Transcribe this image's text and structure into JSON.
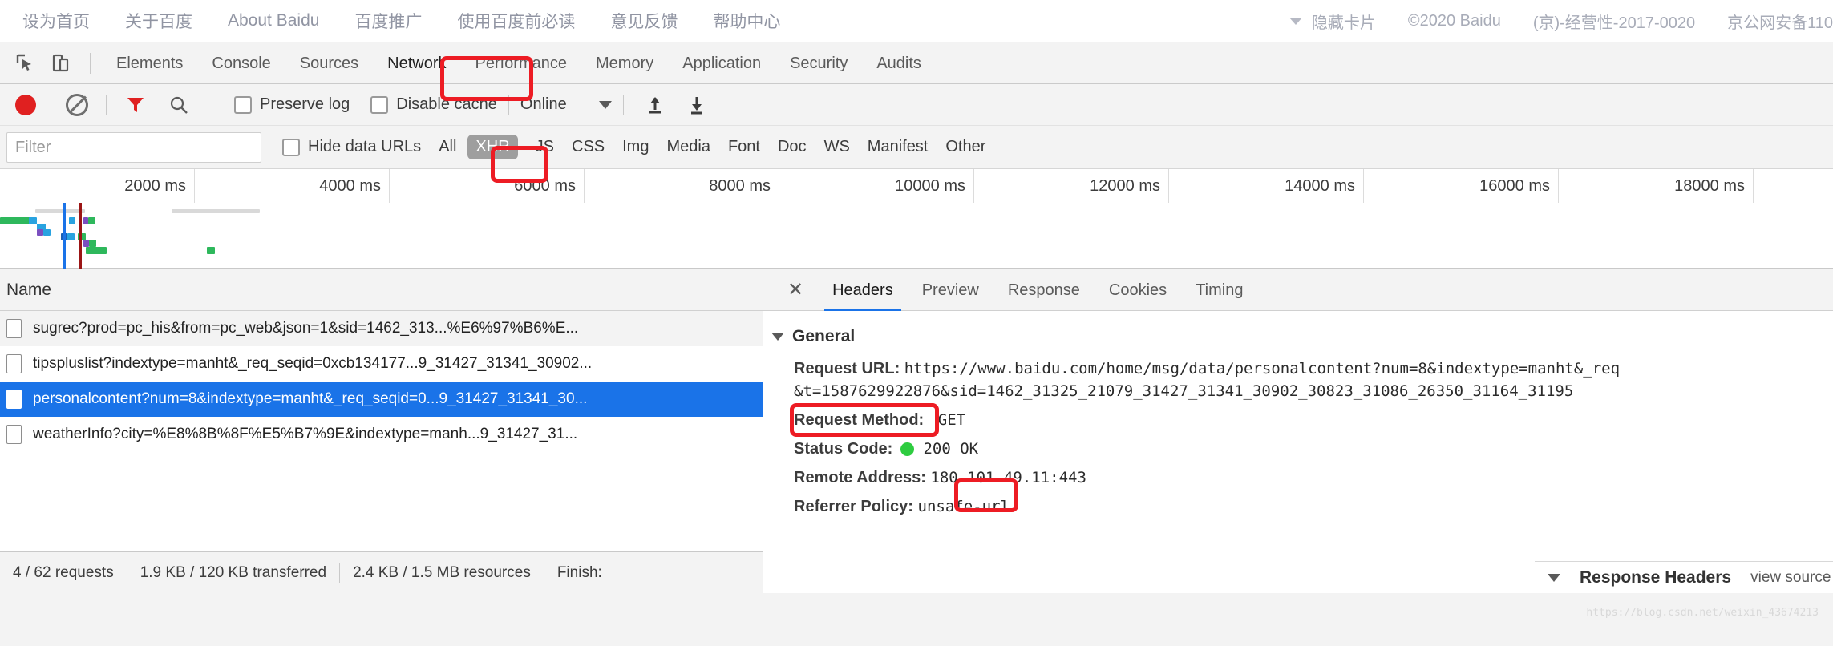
{
  "baidu_footer": {
    "links": [
      "设为首页",
      "关于百度",
      "About Baidu",
      "百度推广",
      "使用百度前必读",
      "意见反馈",
      "帮助中心"
    ],
    "hide_cards": "隐藏卡片",
    "copyright": "©2020 Baidu",
    "license": "(京)-经营性-2017-0020",
    "icp": "京公网安备110"
  },
  "devtools": {
    "tabs": [
      {
        "label": "Elements",
        "active": false
      },
      {
        "label": "Console",
        "active": false
      },
      {
        "label": "Sources",
        "active": false
      },
      {
        "label": "Network",
        "active": true
      },
      {
        "label": "Performance",
        "active": false
      },
      {
        "label": "Memory",
        "active": false
      },
      {
        "label": "Application",
        "active": false
      },
      {
        "label": "Security",
        "active": false
      },
      {
        "label": "Audits",
        "active": false
      }
    ],
    "toolbar": {
      "preserve_log": "Preserve log",
      "disable_cache": "Disable cache",
      "throttle": "Online"
    },
    "filterbar": {
      "filter_placeholder": "Filter",
      "filter_value": "",
      "hide_data_urls": "Hide data URLs",
      "types": [
        "All",
        "XHR",
        "JS",
        "CSS",
        "Img",
        "Media",
        "Font",
        "Doc",
        "WS",
        "Manifest",
        "Other"
      ],
      "selected_type": "XHR"
    },
    "timeline": {
      "ticks": [
        "2000 ms",
        "4000 ms",
        "6000 ms",
        "8000 ms",
        "10000 ms",
        "12000 ms",
        "14000 ms",
        "16000 ms",
        "18000 ms"
      ]
    },
    "list": {
      "column_header": "Name",
      "rows": [
        {
          "name": "sugrec?prod=pc_his&from=pc_web&json=1&sid=1462_313...%E6%97%B6%E...",
          "selected": false
        },
        {
          "name": "tipspluslist?indextype=manht&_req_seqid=0xcb134177...9_31427_31341_30902...",
          "selected": false
        },
        {
          "name": "personalcontent?num=8&indextype=manht&_req_seqid=0...9_31427_31341_30...",
          "selected": true
        },
        {
          "name": "weatherInfo?city=%E8%8B%8F%E5%B7%9E&indextype=manh...9_31427_31...",
          "selected": false
        }
      ]
    },
    "detail": {
      "tabs": [
        {
          "label": "Headers",
          "active": true
        },
        {
          "label": "Preview",
          "active": false
        },
        {
          "label": "Response",
          "active": false
        },
        {
          "label": "Cookies",
          "active": false
        },
        {
          "label": "Timing",
          "active": false
        }
      ],
      "general_title": "General",
      "request_url_label": "Request URL:",
      "request_url_line1": "https://www.baidu.com/home/msg/data/personalcontent?num=8&indextype=manht&_req",
      "request_url_line2": "&t=1587629922876&sid=1462_31325_21079_31427_31341_30902_30823_31086_26350_31164_31195",
      "request_method_label": "Request Method:",
      "request_method": "GET",
      "status_code_label": "Status Code:",
      "status_code": "200  OK",
      "remote_address_label": "Remote Address:",
      "remote_address": "180.101.49.11:443",
      "referrer_policy_label": "Referrer Policy:",
      "referrer_policy": "unsafe-url",
      "response_headers_title": "Response Headers",
      "view_source": "view source"
    },
    "statusbar": {
      "requests": "4 / 62 requests",
      "transferred": "1.9 KB / 120 KB transferred",
      "resources": "2.4 KB / 1.5 MB resources",
      "finish": "Finish:"
    }
  },
  "colors": {
    "accent": "#1a73e8",
    "annotation": "#ed1c24",
    "record": "#e02020",
    "status_ok": "#2ecc40",
    "selected_type_bg": "#9e9e9e"
  },
  "watermark": "https://blog.csdn.net/weixin_43674213"
}
